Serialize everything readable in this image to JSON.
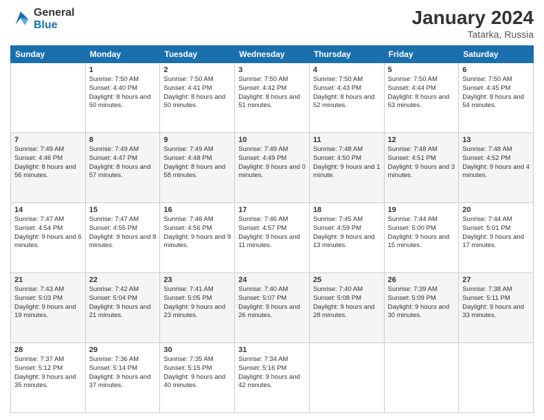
{
  "header": {
    "logo_general": "General",
    "logo_blue": "Blue",
    "month_year": "January 2024",
    "location": "Tatarka, Russia"
  },
  "days_of_week": [
    "Sunday",
    "Monday",
    "Tuesday",
    "Wednesday",
    "Thursday",
    "Friday",
    "Saturday"
  ],
  "weeks": [
    [
      {
        "day": "",
        "sunrise": "",
        "sunset": "",
        "daylight": ""
      },
      {
        "day": "1",
        "sunrise": "Sunrise: 7:50 AM",
        "sunset": "Sunset: 4:40 PM",
        "daylight": "Daylight: 8 hours and 50 minutes."
      },
      {
        "day": "2",
        "sunrise": "Sunrise: 7:50 AM",
        "sunset": "Sunset: 4:41 PM",
        "daylight": "Daylight: 8 hours and 50 minutes."
      },
      {
        "day": "3",
        "sunrise": "Sunrise: 7:50 AM",
        "sunset": "Sunset: 4:42 PM",
        "daylight": "Daylight: 8 hours and 51 minutes."
      },
      {
        "day": "4",
        "sunrise": "Sunrise: 7:50 AM",
        "sunset": "Sunset: 4:43 PM",
        "daylight": "Daylight: 8 hours and 52 minutes."
      },
      {
        "day": "5",
        "sunrise": "Sunrise: 7:50 AM",
        "sunset": "Sunset: 4:44 PM",
        "daylight": "Daylight: 8 hours and 53 minutes."
      },
      {
        "day": "6",
        "sunrise": "Sunrise: 7:50 AM",
        "sunset": "Sunset: 4:45 PM",
        "daylight": "Daylight: 8 hours and 54 minutes."
      }
    ],
    [
      {
        "day": "7",
        "sunrise": "Sunrise: 7:49 AM",
        "sunset": "Sunset: 4:46 PM",
        "daylight": "Daylight: 8 hours and 56 minutes."
      },
      {
        "day": "8",
        "sunrise": "Sunrise: 7:49 AM",
        "sunset": "Sunset: 4:47 PM",
        "daylight": "Daylight: 8 hours and 57 minutes."
      },
      {
        "day": "9",
        "sunrise": "Sunrise: 7:49 AM",
        "sunset": "Sunset: 4:48 PM",
        "daylight": "Daylight: 8 hours and 58 minutes."
      },
      {
        "day": "10",
        "sunrise": "Sunrise: 7:49 AM",
        "sunset": "Sunset: 4:49 PM",
        "daylight": "Daylight: 9 hours and 0 minutes."
      },
      {
        "day": "11",
        "sunrise": "Sunrise: 7:48 AM",
        "sunset": "Sunset: 4:50 PM",
        "daylight": "Daylight: 9 hours and 1 minute."
      },
      {
        "day": "12",
        "sunrise": "Sunrise: 7:48 AM",
        "sunset": "Sunset: 4:51 PM",
        "daylight": "Daylight: 9 hours and 3 minutes."
      },
      {
        "day": "13",
        "sunrise": "Sunrise: 7:48 AM",
        "sunset": "Sunset: 4:52 PM",
        "daylight": "Daylight: 9 hours and 4 minutes."
      }
    ],
    [
      {
        "day": "14",
        "sunrise": "Sunrise: 7:47 AM",
        "sunset": "Sunset: 4:54 PM",
        "daylight": "Daylight: 9 hours and 6 minutes."
      },
      {
        "day": "15",
        "sunrise": "Sunrise: 7:47 AM",
        "sunset": "Sunset: 4:55 PM",
        "daylight": "Daylight: 9 hours and 8 minutes."
      },
      {
        "day": "16",
        "sunrise": "Sunrise: 7:46 AM",
        "sunset": "Sunset: 4:56 PM",
        "daylight": "Daylight: 9 hours and 9 minutes."
      },
      {
        "day": "17",
        "sunrise": "Sunrise: 7:46 AM",
        "sunset": "Sunset: 4:57 PM",
        "daylight": "Daylight: 9 hours and 11 minutes."
      },
      {
        "day": "18",
        "sunrise": "Sunrise: 7:45 AM",
        "sunset": "Sunset: 4:59 PM",
        "daylight": "Daylight: 9 hours and 13 minutes."
      },
      {
        "day": "19",
        "sunrise": "Sunrise: 7:44 AM",
        "sunset": "Sunset: 5:00 PM",
        "daylight": "Daylight: 9 hours and 15 minutes."
      },
      {
        "day": "20",
        "sunrise": "Sunrise: 7:44 AM",
        "sunset": "Sunset: 5:01 PM",
        "daylight": "Daylight: 9 hours and 17 minutes."
      }
    ],
    [
      {
        "day": "21",
        "sunrise": "Sunrise: 7:43 AM",
        "sunset": "Sunset: 5:03 PM",
        "daylight": "Daylight: 9 hours and 19 minutes."
      },
      {
        "day": "22",
        "sunrise": "Sunrise: 7:42 AM",
        "sunset": "Sunset: 5:04 PM",
        "daylight": "Daylight: 9 hours and 21 minutes."
      },
      {
        "day": "23",
        "sunrise": "Sunrise: 7:41 AM",
        "sunset": "Sunset: 5:05 PM",
        "daylight": "Daylight: 9 hours and 23 minutes."
      },
      {
        "day": "24",
        "sunrise": "Sunrise: 7:40 AM",
        "sunset": "Sunset: 5:07 PM",
        "daylight": "Daylight: 9 hours and 26 minutes."
      },
      {
        "day": "25",
        "sunrise": "Sunrise: 7:40 AM",
        "sunset": "Sunset: 5:08 PM",
        "daylight": "Daylight: 9 hours and 28 minutes."
      },
      {
        "day": "26",
        "sunrise": "Sunrise: 7:39 AM",
        "sunset": "Sunset: 5:09 PM",
        "daylight": "Daylight: 9 hours and 30 minutes."
      },
      {
        "day": "27",
        "sunrise": "Sunrise: 7:38 AM",
        "sunset": "Sunset: 5:11 PM",
        "daylight": "Daylight: 9 hours and 33 minutes."
      }
    ],
    [
      {
        "day": "28",
        "sunrise": "Sunrise: 7:37 AM",
        "sunset": "Sunset: 5:12 PM",
        "daylight": "Daylight: 9 hours and 35 minutes."
      },
      {
        "day": "29",
        "sunrise": "Sunrise: 7:36 AM",
        "sunset": "Sunset: 5:14 PM",
        "daylight": "Daylight: 9 hours and 37 minutes."
      },
      {
        "day": "30",
        "sunrise": "Sunrise: 7:35 AM",
        "sunset": "Sunset: 5:15 PM",
        "daylight": "Daylight: 9 hours and 40 minutes."
      },
      {
        "day": "31",
        "sunrise": "Sunrise: 7:34 AM",
        "sunset": "Sunset: 5:16 PM",
        "daylight": "Daylight: 9 hours and 42 minutes."
      },
      {
        "day": "",
        "sunrise": "",
        "sunset": "",
        "daylight": ""
      },
      {
        "day": "",
        "sunrise": "",
        "sunset": "",
        "daylight": ""
      },
      {
        "day": "",
        "sunrise": "",
        "sunset": "",
        "daylight": ""
      }
    ]
  ]
}
